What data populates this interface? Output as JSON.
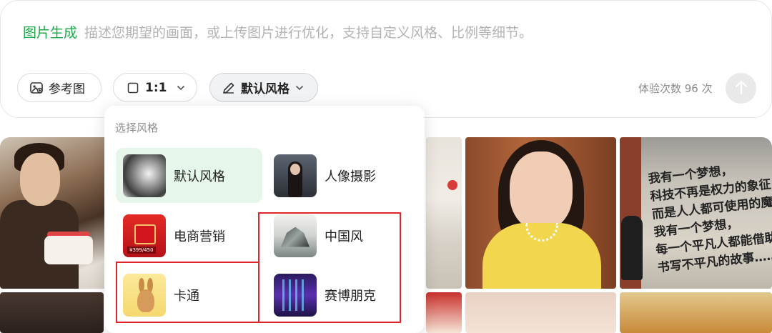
{
  "composer": {
    "mode_label": "图片生成",
    "prompt_placeholder": "描述您期望的画面，或上传图片进行优化，支持自定义风格、比例等细节。",
    "reference_label": "参考图",
    "ratio_value": "1:1",
    "style_label": "默认风格",
    "quota_text": "体验次数 96 次"
  },
  "style_dropdown": {
    "title": "选择风格",
    "options": [
      {
        "label": "默认风格",
        "selected": true
      },
      {
        "label": "人像摄影",
        "selected": false
      },
      {
        "label": "电商营销",
        "selected": false
      },
      {
        "label": "中国风",
        "selected": false
      },
      {
        "label": "卡通",
        "selected": false
      },
      {
        "label": "赛博朋克",
        "selected": false
      }
    ],
    "ecom_thumb_tag": "¥399/450"
  },
  "gallery": {
    "wall_text": "我有一个梦想，\n科技不再是权力的象征，\n而是人人都可使用的魔法；\n我有一个梦想，\n每一个平凡人都能借助AI\n书写不平凡的故事……"
  },
  "colors": {
    "accent_green": "#1fa84a",
    "selected_bg": "#e7f6ea",
    "highlight_red": "#e0262c",
    "placeholder_gray": "#b3b3b3"
  },
  "icons": [
    "image-reference-icon",
    "square-ratio-icon",
    "chevron-down-icon",
    "pen-icon",
    "arrow-up-icon"
  ]
}
